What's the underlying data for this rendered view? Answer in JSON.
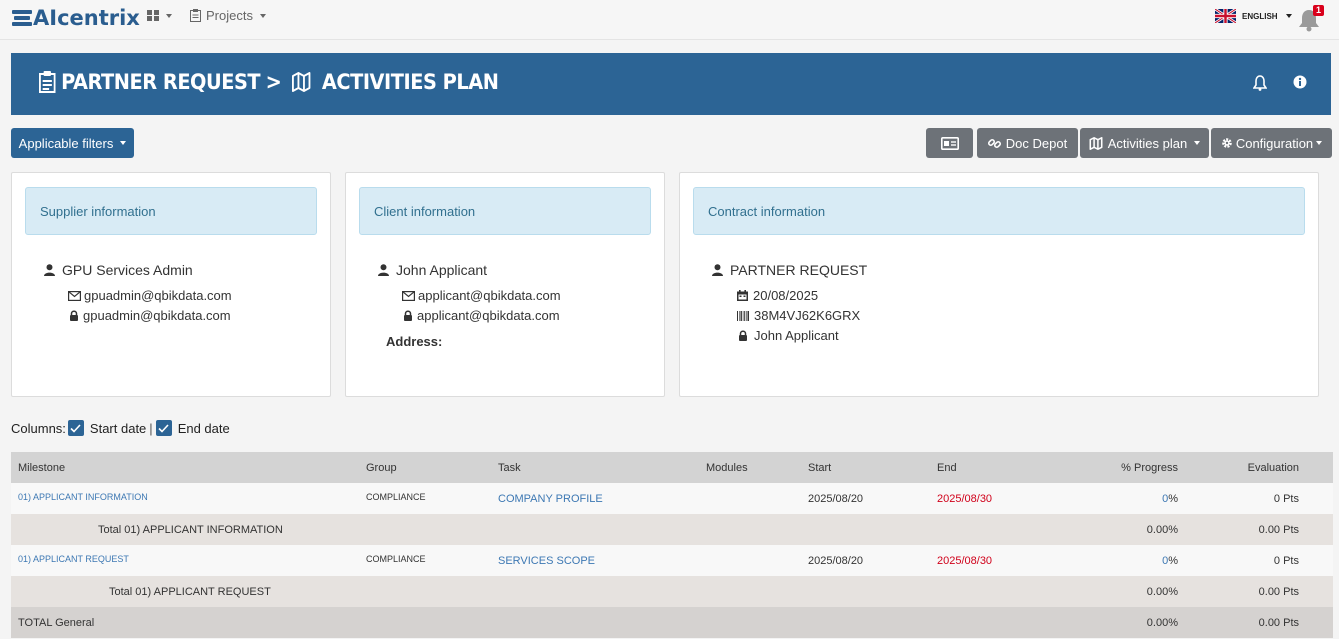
{
  "app": {
    "logo_text": "AIcentrix",
    "projects_label": "Projects",
    "language": "ENGLISH",
    "notification_count": "1"
  },
  "banner": {
    "title_part1": "PARTNER REQUEST",
    "separator": ">",
    "title_part2": "ACTIVITIES PLAN"
  },
  "toolbar": {
    "filters_label": "Applicable filters",
    "doc_depot_label": "Doc Depot",
    "activities_plan_label": "Activities plan",
    "configuration_label": "Configuration"
  },
  "supplier": {
    "header": "Supplier information",
    "name": "GPU Services Admin",
    "email": "gpuadmin@qbikdata.com",
    "login": "gpuadmin@qbikdata.com"
  },
  "client": {
    "header": "Client information",
    "name": "John Applicant",
    "email": "applicant@qbikdata.com",
    "login": "applicant@qbikdata.com",
    "address_label": "Address:"
  },
  "contract": {
    "header": "Contract information",
    "name": "PARTNER REQUEST",
    "date": "20/08/2025",
    "code": "38M4VJ62K6GRX",
    "owner": "John Applicant"
  },
  "columns": {
    "label": "Columns:",
    "start_date": "Start date",
    "separator": "|",
    "end_date": "End date"
  },
  "table": {
    "headers": [
      "Milestone",
      "Group",
      "Task",
      "Modules",
      "Start",
      "End",
      "% Progress",
      "Evaluation"
    ],
    "rows": [
      {
        "milestone": "01) APPLICANT INFORMATION",
        "group": "COMPLIANCE",
        "task": "COMPANY PROFILE",
        "modules": "",
        "start": "2025/08/20",
        "end": "2025/08/30",
        "progress_value": "0",
        "progress_unit": "%",
        "evaluation": "0 Pts"
      },
      {
        "total_label": "Total 01) APPLICANT INFORMATION",
        "progress": "0.00%",
        "evaluation": "0.00 Pts"
      },
      {
        "milestone": "01) APPLICANT REQUEST",
        "group": "COMPLIANCE",
        "task": "SERVICES SCOPE",
        "modules": "",
        "start": "2025/08/20",
        "end": "2025/08/30",
        "progress_value": "0",
        "progress_unit": "%",
        "evaluation": "0 Pts"
      },
      {
        "total_label": "Total 01) APPLICANT REQUEST",
        "progress": "0.00%",
        "evaluation": "0.00 Pts"
      },
      {
        "total_label": "TOTAL General",
        "progress": "0.00%",
        "evaluation": "0.00 Pts"
      }
    ]
  },
  "colors": {
    "primary": "#2c6495",
    "secondary_button": "#6d7278",
    "panel_header_bg": "#d8ebf5",
    "link": "#3d78b3",
    "overdue": "#d0021b",
    "badge": "#d9001b"
  },
  "icons": [
    "grid-icon",
    "clipboard-icon",
    "uk-flag-icon",
    "bell-icon",
    "map-icon",
    "info-icon",
    "id-card-icon",
    "link-icon",
    "gear-icon",
    "user-icon",
    "envelope-icon",
    "lock-icon",
    "calendar-icon",
    "barcode-icon",
    "checkbox-icon"
  ]
}
